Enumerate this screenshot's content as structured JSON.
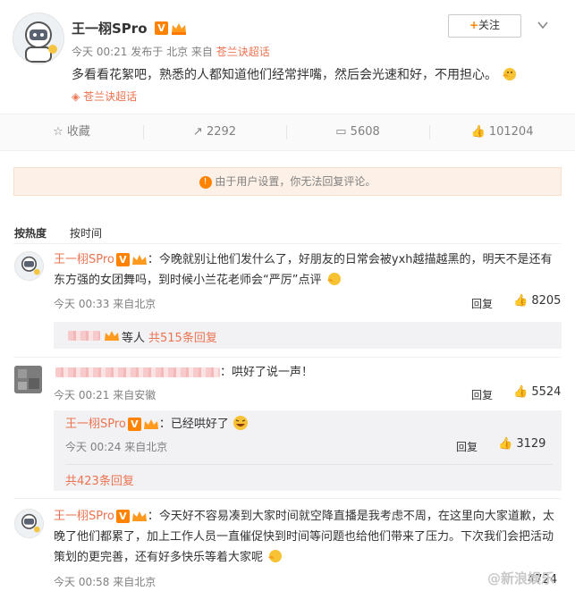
{
  "post": {
    "author": "王一栩SPro",
    "follow_label": "关注",
    "meta_time": "今天 00:21",
    "meta_from_prefix": "发布于",
    "meta_location": "北京",
    "meta_source_prefix": "来自",
    "meta_source": "苍兰诀超话",
    "content": "多看看花絮吧，熟悉的人都知道他们经常拌嘴，然后会光速和好，不用担心。",
    "topic": "苍兰诀超话",
    "v_badge": "V"
  },
  "actions": {
    "favorite_label": "收藏",
    "repost_count": "2292",
    "comment_count": "5608",
    "like_count": "101204"
  },
  "notice": {
    "text": "由于用户设置，你无法回复评论。"
  },
  "tabs": {
    "hot": "按热度",
    "time": "按时间"
  },
  "comments": [
    {
      "author": "王一栩SPro",
      "text_line1": "：今晚就别让他们发什么了，好朋友的日常会被yxh越描越黑的，明天不是还有",
      "text_line2": "东方强的女团舞吗，到时候小兰花老师会“严厉”点评",
      "time": "今天 00:33",
      "location": "来自北京",
      "reply_label": "回复",
      "likes": "8205",
      "sub_summary_suffix": "等人",
      "sub_summary_link": "共515条回复"
    },
    {
      "text": "：哄好了说一声！",
      "time": "今天 00:21",
      "location": "来自安徽",
      "reply_label": "回复",
      "likes": "5524",
      "sub_reply": {
        "author": "王一栩SPro",
        "text": "：已经哄好了",
        "time": "今天 00:24",
        "location": "来自北京",
        "reply_label": "回复",
        "likes": "3129"
      },
      "sub_summary_link": "共423条回复"
    },
    {
      "author": "王一栩SPro",
      "text_line1": "：今天好不容易凑到大家时间就空降直播是我考虑不周，在这里向大家道歉，太",
      "text_line2": "晚了他们都累了，加上工作人员一直催促快到时间等问题也给他们带来了压力。下次我们会把活动",
      "text_line3": "策划的更完善，还有好多快乐等着大家呢",
      "time": "今天 00:58",
      "location": "来自北京",
      "likes": "4724"
    }
  ],
  "watermark": "@新浪娱乐",
  "icons": [
    "avatar-astronaut",
    "v-badge",
    "crown-icon",
    "chevron-down-icon",
    "star-icon",
    "repost-icon",
    "comment-icon",
    "like-icon",
    "warning-icon",
    "topic-icon",
    "hug-emoji",
    "laugh-emoji"
  ]
}
